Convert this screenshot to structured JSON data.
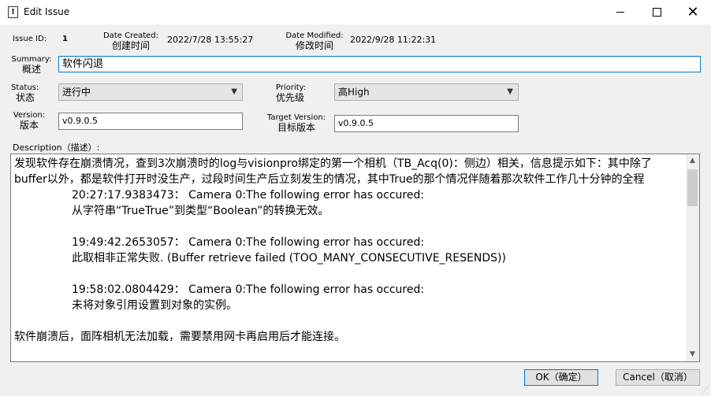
{
  "window": {
    "title": "Edit Issue",
    "minimize": "—",
    "maximize": "",
    "close": "✕"
  },
  "header": {
    "issue_id_label": "Issue ID:",
    "issue_id": "1",
    "date_created_label": "Date Created:",
    "date_created_cn": "创建时间",
    "date_created": "2022/7/28 13:55:27",
    "date_modified_label": "Date Modified:",
    "date_modified_cn": "修改时间",
    "date_modified": "2022/9/28 11:22:31"
  },
  "summary": {
    "label": "Summary:",
    "label_cn": "概述",
    "value": "软件闪退"
  },
  "status": {
    "label": "Status:",
    "label_cn": "状态",
    "value": "进行中"
  },
  "priority": {
    "label": "Priority:",
    "label_cn": "优先级",
    "value": "高High"
  },
  "version": {
    "label": "Version:",
    "label_cn": "版本",
    "value": "v0.9.0.5"
  },
  "target_version": {
    "label": "Target Version:",
    "label_cn": "目标版本",
    "value": "v0.9.0.5"
  },
  "description": {
    "label": "Description（描述）:",
    "intro": "发现软件存在崩溃情况，查到3次崩溃时的log与visionpro绑定的第一个相机（TB_Acq(0)：侧边）相关，信息提示如下：其中除了buffer以外，都是软件打开时没生产，过段时间生产后立刻发生的情况，其中True的那个情况伴随着那次软件工作几十分钟的全程",
    "entries": [
      {
        "line1": "20:27:17.9383473： Camera 0:The following error has occured:",
        "line2": "从字符串“TrueTrue”到类型“Boolean”的转换无效。"
      },
      {
        "line1": "19:49:42.2653057： Camera 0:The following error has occured:",
        "line2": "此取相非正常失败. (Buffer retrieve failed (TOO_MANY_CONSECUTIVE_RESENDS))"
      },
      {
        "line1": "19:58:02.0804429： Camera 0:The following error has occured:",
        "line2": "未将对象引用设置到对象的实例。"
      }
    ],
    "footer": "软件崩溃后，面阵相机无法加载，需要禁用网卡再启用后才能连接。"
  },
  "buttons": {
    "ok": "OK（确定）",
    "cancel": "Cancel（取消）"
  }
}
